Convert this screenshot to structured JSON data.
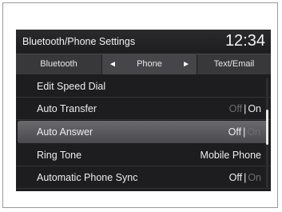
{
  "header": {
    "title": "Bluetooth/Phone Settings",
    "clock": "12:34"
  },
  "tabs": {
    "left": "Bluetooth",
    "center": "Phone",
    "right": "Text/Email",
    "prev_arrow": "◄",
    "next_arrow": "►"
  },
  "menu": [
    {
      "label": "Edit Speed Dial"
    },
    {
      "label": "Auto Transfer",
      "options": [
        "Off",
        "On"
      ],
      "selected": "On"
    },
    {
      "label": "Auto Answer",
      "options": [
        "Off",
        "On"
      ],
      "selected": "Off"
    },
    {
      "label": "Ring Tone",
      "value": "Mobile Phone"
    },
    {
      "label": "Automatic Phone Sync",
      "options": [
        "Off",
        "On"
      ],
      "selected": "Off"
    }
  ],
  "separator": "|",
  "selected_row": 2,
  "scroll": {
    "position": 0.5
  },
  "colors": {
    "screen_bg": "#1d1d1f",
    "text": "#ededed",
    "dim_text": "#6e6e70",
    "highlight": "#5a5a5e"
  }
}
